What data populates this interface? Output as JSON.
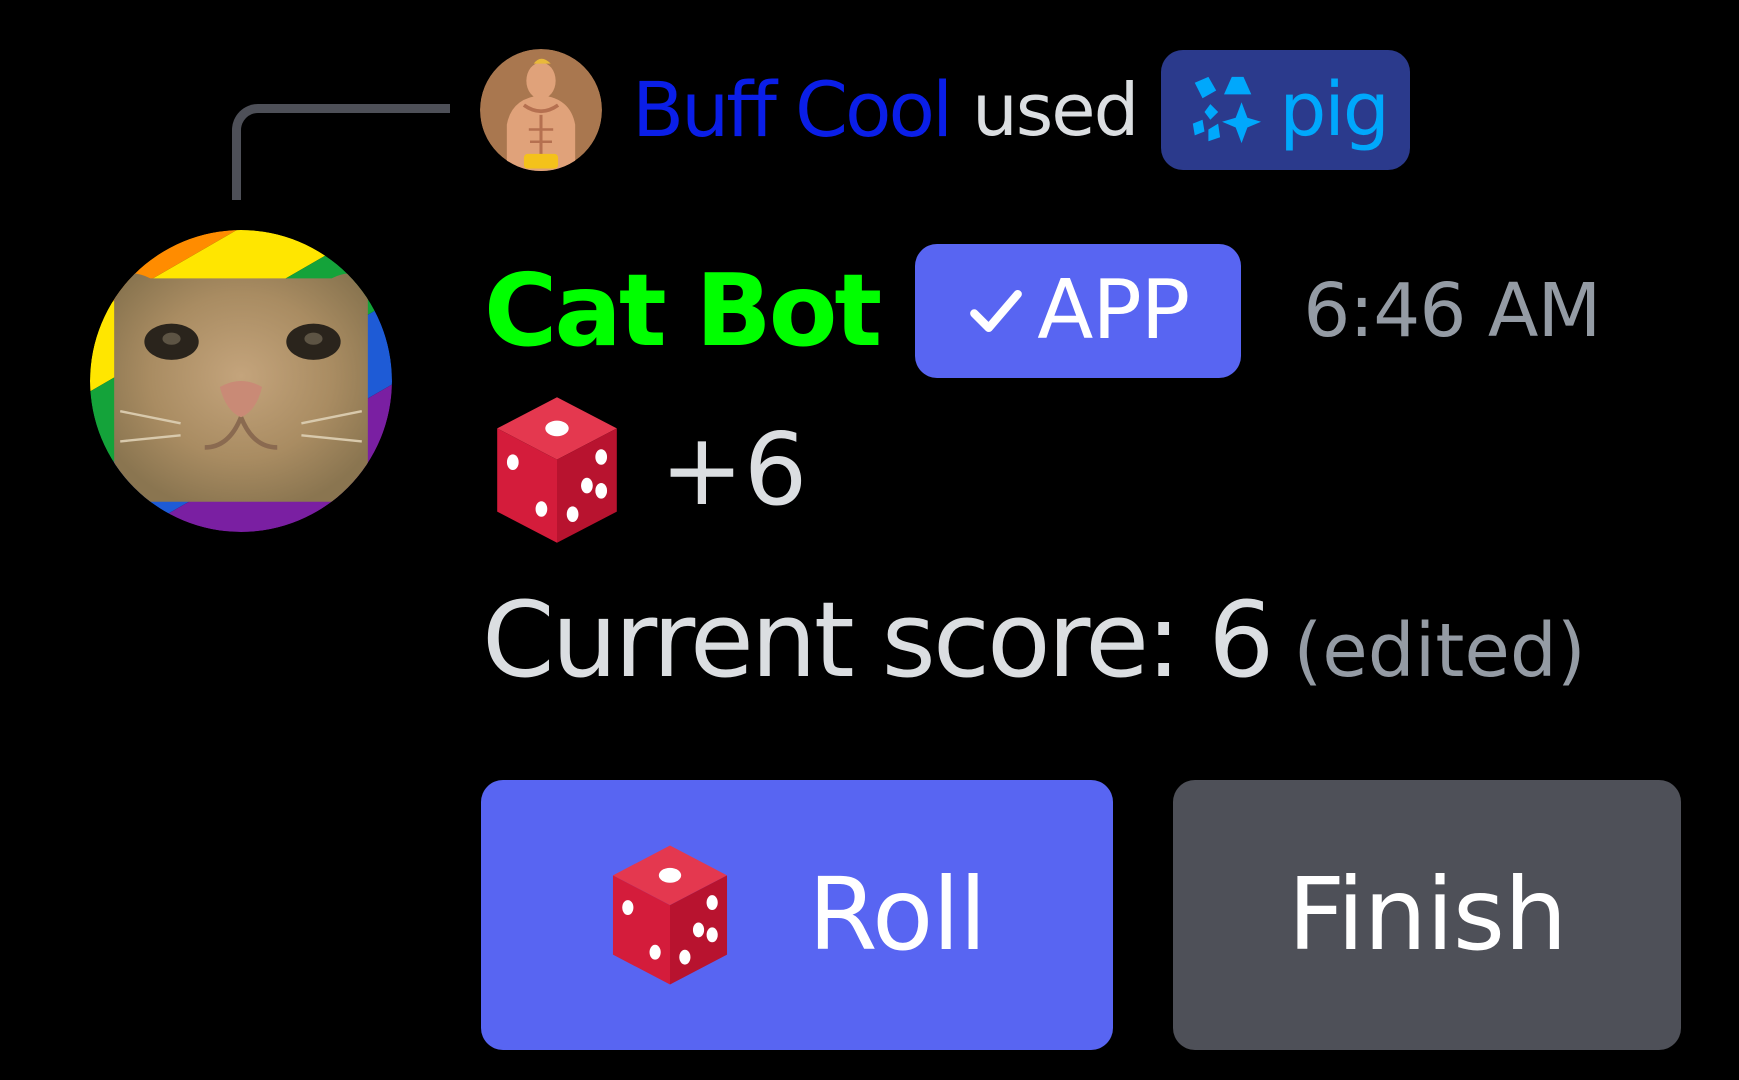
{
  "colors": {
    "background": "#000000",
    "connector": "#4e5058",
    "reply_user": "#0a1ee8",
    "command_pill_bg": "#2b3a8c",
    "command_text": "#00a8fc",
    "bot_name": "#00ff00",
    "blurple": "#5865f2",
    "secondary_button": "#4e5058",
    "muted_text": "#949ba4",
    "text": "#dbdee1",
    "dice_red": "#d41c3b"
  },
  "reply": {
    "avatar_icon": "muscular-man-avatar",
    "username": "Buff Cool",
    "action_text": "used",
    "command": {
      "icon": "app-command-icon",
      "name": "pig"
    }
  },
  "message": {
    "avatar_icon": "cat-avatar-rainbow-frame",
    "author": "Cat Bot",
    "badge": {
      "icon": "checkmark-icon",
      "label": "APP"
    },
    "timestamp": "6:46 AM",
    "dice": {
      "icon": "game-die-icon",
      "value": "+6"
    },
    "score_text": "Current score: 6",
    "edited_label": "(edited)"
  },
  "buttons": {
    "roll": {
      "icon": "game-die-icon",
      "label": "Roll",
      "style": "primary"
    },
    "finish": {
      "label": "Finish",
      "style": "secondary"
    }
  }
}
